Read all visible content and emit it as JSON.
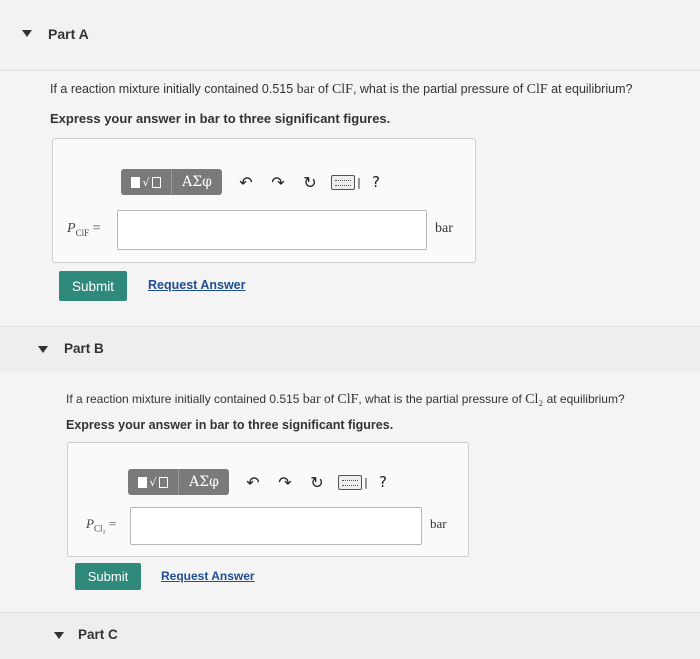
{
  "part_a": {
    "title": "Part A",
    "question_pre": "If a reaction mixture initially contained 0.515 ",
    "question_unit": "bar",
    "question_mid": " of ",
    "question_chem": "ClF",
    "question_post": ", what is the partial pressure of ",
    "question_chem2": "ClF",
    "question_end": " at equilibrium?",
    "instruction": "Express your answer in bar to three significant figures.",
    "toolbar": {
      "greek": "ΑΣφ",
      "help": "?"
    },
    "var_main": "P",
    "var_sub": "ClF",
    "var_eq": " =",
    "input_value": "",
    "unit": "bar",
    "submit": "Submit",
    "request": "Request Answer"
  },
  "part_b": {
    "title": "Part B",
    "question_pre": "If a reaction mixture initially contained 0.515 ",
    "question_unit": "bar",
    "question_mid": " of ",
    "question_chem": "ClF",
    "question_post": ", what is the partial pressure of ",
    "question_chem2": "Cl₂",
    "question_end": " at equilibrium?",
    "instruction": "Express your answer in bar to three significant figures.",
    "toolbar": {
      "greek": "ΑΣφ",
      "help": "?"
    },
    "var_main": "P",
    "var_sub": "Cl₂",
    "var_eq": " =",
    "input_value": "",
    "unit": "bar",
    "submit": "Submit",
    "request": "Request Answer"
  },
  "part_c": {
    "title": "Part C"
  },
  "icons": {
    "undo": "↶",
    "redo": "↷",
    "reset": "↻"
  }
}
